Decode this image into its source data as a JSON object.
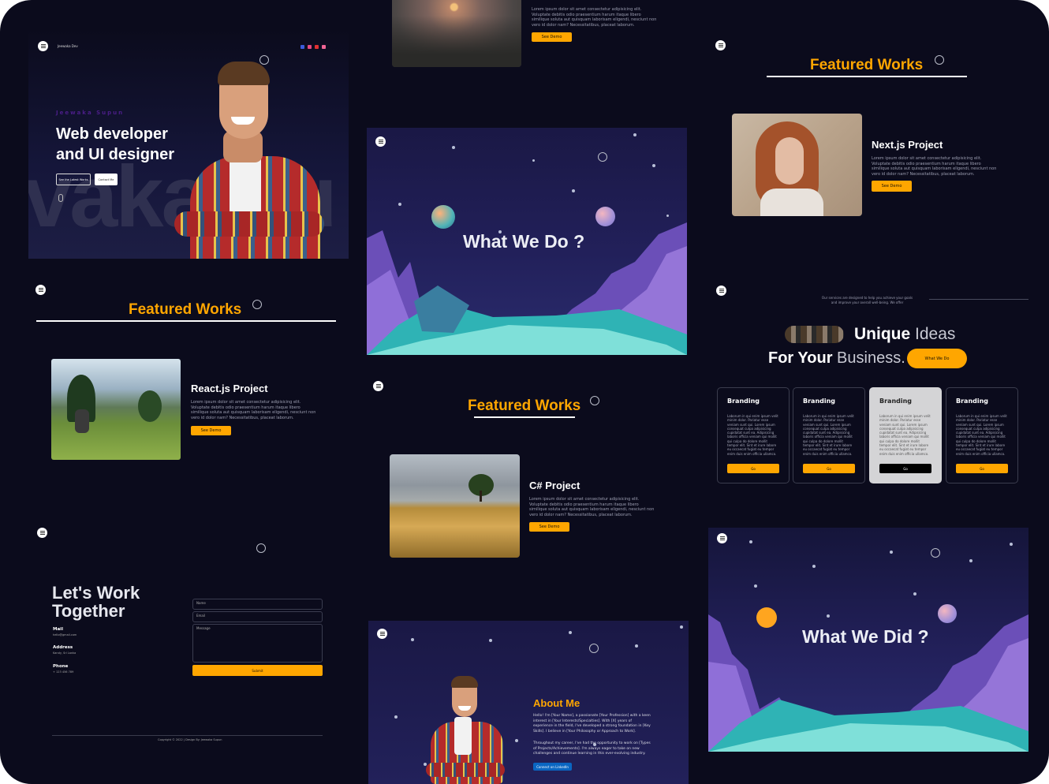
{
  "colors": {
    "background": "#0b0b1c",
    "accent": "#ffa600",
    "text": "#ffffff",
    "muted": "#9d9fb2",
    "purple": "#4b1e88",
    "linkedin": "#0a66c2"
  },
  "hero": {
    "logo": "Jeewaka Dev",
    "social_icons": [
      "facebook-icon",
      "instagram-icon",
      "youtube-icon",
      "dribbble-icon"
    ],
    "subtitle": "Jeewaka Supun",
    "title_line1": "Web developer",
    "title_line2": "and UI designer",
    "btn_primary": "See the Latest Works",
    "btn_secondary": "Contact Me",
    "watermark": "vaka Su"
  },
  "lorem": "Lorem ipsum dolor sit amet consectetur adipisicing elit. Voluptate debitis odio praesentium harum itaque libero similique soluta aut quisquam laborisam eligendi, nesciunt non vero id dolor nam? Necessitatibus, placeat laborum.",
  "featured_heading": "Featured Works",
  "see_demo": "See Demo",
  "projects": {
    "react": "React.js Project",
    "csharp": "C# Project",
    "next": "Next.js Project"
  },
  "what_we_do": "What We Do ?",
  "what_we_did": "What We Did ?",
  "contact": {
    "title_line1": "Let's Work",
    "title_line2": "Together",
    "mail_label": "Mail",
    "mail_value": "hello@gmail.com",
    "address_label": "Address",
    "address_value": "Kandy, Sri Lanka",
    "phone_label": "Phone",
    "phone_value": "+ 123 456 789",
    "name_ph": "Name",
    "email_ph": "Email",
    "message_ph": "Message",
    "submit": "Submit",
    "copyright": "Copyright © 2022 | Design By: Jeewaka Supun"
  },
  "about": {
    "title": "About Me",
    "para1": "Hello! I'm [Your Name], a passionate [Your Profession] with a keen interest in [Your Interests/Specialties]. With [X] years of experience in the field, I've developed a strong foundation in [Key Skills]. I believe in [Your Philosophy or Approach to Work].",
    "para2": "Throughout my career, I've had the opportunity to work on [Types of Projects/Achievements]. I'm always eager to take on new challenges and continue learning in this ever-evolving industry.",
    "linkedin": "Connect on LinkedIn"
  },
  "services": {
    "intro_line1": "Our services are designed to help you achieve your goals",
    "intro_line2": "and improve your overall well-being. We offer",
    "heading1_bold": "Unique",
    "heading1_light": "Ideas",
    "heading2_bold": "For Your",
    "heading2_light": "Business.",
    "cta": "What We Do",
    "cards": [
      {
        "title": "Branding",
        "text": "Laborum in qui enim ipsum velit minim dolor. Pariatur esse veniam sunt qui. Lorem ipsum consequat culpa adipisicing cupidatat sunt ea. Adipisicing laboris officia veniam qui mollit qui culpa do dolore mollit tempor elit. Sint et irure labore eu occaecat fugiat eu tempor enim duis enim officia ullamco.",
        "button": "Go"
      },
      {
        "title": "Branding",
        "text": "Laborum in qui enim ipsum velit minim dolor. Pariatur esse veniam sunt qui. Lorem ipsum consequat culpa adipisicing cupidatat sunt ea. Adipisicing laboris officia veniam qui mollit qui culpa do dolore mollit tempor elit. Sint et irure labore eu occaecat fugiat eu tempor enim duis enim officia ullamco.",
        "button": "Go"
      },
      {
        "title": "Branding",
        "text": "Laborum in qui enim ipsum velit minim dolor. Pariatur esse veniam sunt qui. Lorem ipsum consequat culpa adipisicing cupidatat sunt ea. Adipisicing laboris officia veniam qui mollit qui culpa do dolore mollit tempor elit. Sint et irure labore eu occaecat fugiat eu tempor enim duis enim officia ullamco.",
        "button": "Go"
      },
      {
        "title": "Branding",
        "text": "Laborum in qui enim ipsum velit minim dolor. Pariatur esse veniam sunt qui. Lorem ipsum consequat culpa adipisicing cupidatat sunt ea. Adipisicing laboris officia veniam qui mollit qui culpa do dolore mollit tempor elit. Sint et irure labore eu occaecat fugiat eu tempor enim duis enim officia ullamco.",
        "button": "Go"
      }
    ]
  }
}
